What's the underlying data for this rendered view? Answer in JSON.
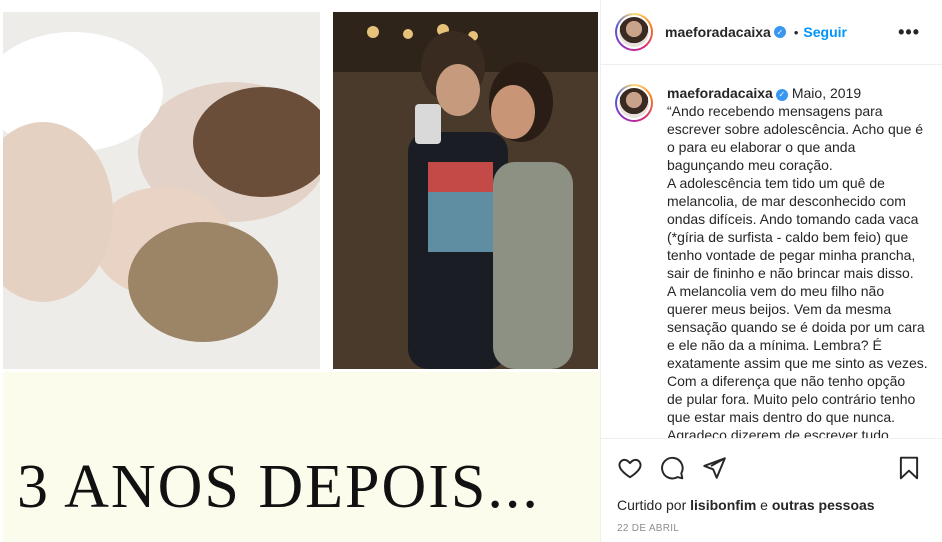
{
  "post": {
    "username": "maeforadacaixa",
    "follow_label": "Seguir",
    "dot": "•",
    "more": "•••",
    "verified_mark": "✓"
  },
  "media": {
    "caption_text": "3 ANOS DEPOIS..."
  },
  "comment": {
    "username": "maeforadacaixa",
    "date": "Maio, 2019",
    "lines": [
      "“Ando recebendo mensagens para",
      "escrever sobre adolescência. Acho que é",
      "o para eu elaborar o que anda",
      "bagunçando meu coração.",
      "A adolescência tem tido um quê de",
      "melancolia, de mar desconhecido com",
      "ondas difíceis. Ando tomando cada vaca",
      "(*gíria de surfista - caldo bem feio) que",
      "tenho vontade de pegar minha prancha,",
      "sair de fininho e não brincar mais disso.",
      "A melancolia vem do meu filho não",
      "querer meus beijos. Vem da mesma",
      "sensação quando se é doida por um cara",
      "e ele não da a mínima. Lembra? É",
      "exatamente assim que me sinto as vezes.",
      "Com a diferença que não tenho opção",
      "de pular fora. Muito pelo contrário tenho",
      "que estar mais dentro do que nunca.",
      "Agradeço dizerem de escrever tudo"
    ]
  },
  "likes": {
    "prefix": "Curtido por",
    "user": "lisibonfim",
    "joiner": "e",
    "others": "outras pessoas"
  },
  "timestamp": "22 DE ABRIL",
  "icons": {
    "like": "heart-icon",
    "comment": "comment-icon",
    "share": "share-icon",
    "save": "bookmark-icon",
    "more": "more-icon"
  },
  "colors": {
    "accent": "#0095f6",
    "verified": "#3897f0",
    "caption_bg": "#fbfcec"
  }
}
